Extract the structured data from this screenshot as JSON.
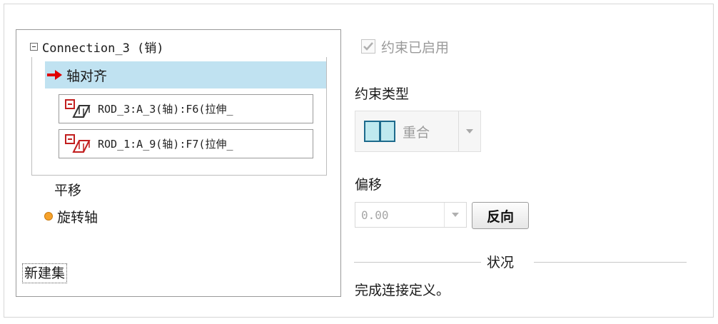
{
  "tree": {
    "root_label": "Connection_3 (销)",
    "axis_label": "轴对齐",
    "references": [
      "ROD_3:A_3(轴):F6(拉伸_",
      "ROD_1:A_9(轴):F7(拉伸_"
    ],
    "translate_label": "平移",
    "rotation_label": "旋转轴",
    "new_set_label": "新建集"
  },
  "constraint": {
    "enabled_label": "约束已启用",
    "enabled_checked": true,
    "type_label": "约束类型",
    "type_value": "重合"
  },
  "offset": {
    "label": "偏移",
    "value": "0.00",
    "flip_label": "反向"
  },
  "status": {
    "title": "状况",
    "message": "完成连接定义。"
  },
  "icons": {
    "collapse": "minus-box-icon",
    "arrow": "red-arrow-icon",
    "reference": "axis-reference-icon",
    "rotation": "orange-dot-icon",
    "coincide": "coincident-icon"
  },
  "colors": {
    "selection": "#c0e2f1",
    "arrow": "#e00000",
    "dot": "#f6a22b"
  }
}
